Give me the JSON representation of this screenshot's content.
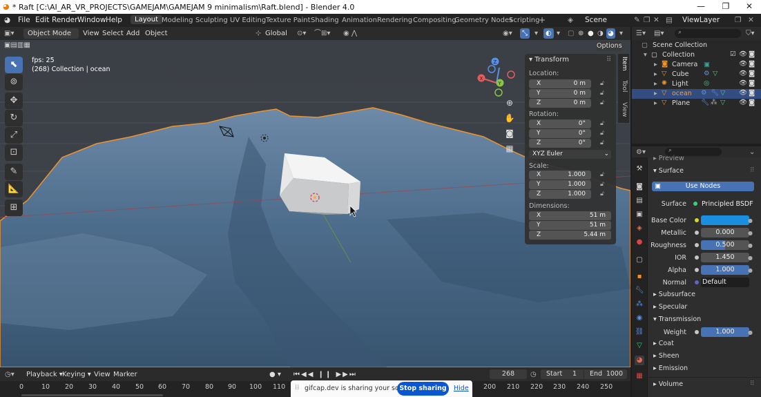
{
  "titlebar": {
    "title": "* Raft [C:\\AI_AR_VR_PROJECTS\\GAMEJAM\\GAMEJAM 9 minimalism\\Raft.blend] - Blender 4.0",
    "min": "—",
    "max": "❐",
    "close": "✕"
  },
  "menu": {
    "items": [
      "File",
      "Edit",
      "Render",
      "Window",
      "Help"
    ]
  },
  "workspaces": [
    "Layout",
    "Modeling",
    "Sculpting",
    "UV Editing",
    "Texture Paint",
    "Shading",
    "Animation",
    "Rendering",
    "Compositing",
    "Geometry Nodes",
    "Scripting"
  ],
  "scene": {
    "label": "Scene",
    "viewlayer": "ViewLayer"
  },
  "vpheader": {
    "mode": "Object Mode",
    "menus": [
      "View",
      "Select",
      "Add",
      "Object"
    ],
    "orientation": "Global",
    "options": "Options"
  },
  "viewport": {
    "fps": "fps: 25",
    "info": "(268) Collection | ocean",
    "gizmo": {
      "x": "X",
      "y": "Y",
      "z": "Z"
    }
  },
  "npanel": {
    "title": "Transform",
    "location_label": "Location:",
    "location": [
      {
        "k": "X",
        "v": "0 m"
      },
      {
        "k": "Y",
        "v": "0 m"
      },
      {
        "k": "Z",
        "v": "0 m"
      }
    ],
    "rotation_label": "Rotation:",
    "rotation": [
      {
        "k": "X",
        "v": "0°"
      },
      {
        "k": "Y",
        "v": "0°"
      },
      {
        "k": "Z",
        "v": "0°"
      }
    ],
    "euler": "XYZ Euler",
    "scale_label": "Scale:",
    "scale": [
      {
        "k": "X",
        "v": "1.000"
      },
      {
        "k": "Y",
        "v": "1.000"
      },
      {
        "k": "Z",
        "v": "1.000"
      }
    ],
    "dimensions_label": "Dimensions:",
    "dimensions": [
      {
        "k": "X",
        "v": "51 m"
      },
      {
        "k": "Y",
        "v": "51 m"
      },
      {
        "k": "Z",
        "v": "5.44 m"
      }
    ],
    "tabs": [
      "Item",
      "Tool",
      "View"
    ]
  },
  "outliner": {
    "root": "Scene Collection",
    "collection": "Collection",
    "items": [
      "Camera",
      "Cube",
      "Light",
      "ocean",
      "Plane"
    ],
    "selected": "ocean"
  },
  "props": {
    "preview": "Preview",
    "surface_section": "Surface",
    "use_nodes": "Use Nodes",
    "surface_label": "Surface",
    "surface_value": "Principled BSDF",
    "base_color_label": "Base Color",
    "base_color": "#1a8fe0",
    "metallic_label": "Metallic",
    "metallic": "0.000",
    "roughness_label": "Roughness",
    "roughness": "0.500",
    "roughness_fill": 0.5,
    "ior_label": "IOR",
    "ior": "1.450",
    "alpha_label": "Alpha",
    "alpha": "1.000",
    "alpha_fill": 1.0,
    "normal_label": "Normal",
    "normal": "Default",
    "subsurface": "Subsurface",
    "specular": "Specular",
    "transmission": "Transmission",
    "weight_label": "Weight",
    "weight": "1.000",
    "weight_fill": 1.0,
    "coat": "Coat",
    "sheen": "Sheen",
    "emission": "Emission",
    "volume": "Volume"
  },
  "timeline": {
    "menus": [
      "Playback",
      "Keying",
      "View",
      "Marker"
    ],
    "frame": "268",
    "start_label": "Start",
    "start": "1",
    "end_label": "End",
    "end": "1000",
    "ticks": [
      "0",
      "10",
      "20",
      "30",
      "40",
      "50",
      "60",
      "70",
      "80",
      "90",
      "100",
      "110",
      "200",
      "210",
      "220",
      "230",
      "240",
      "250"
    ]
  },
  "share": {
    "text": "gifcap.dev is sharing your screen.",
    "stop": "Stop sharing",
    "hide": "Hide"
  },
  "colors": {
    "accent": "#4772b3",
    "selection_outline": "#f0922b",
    "ocean_mid": "#4d6d8c"
  }
}
